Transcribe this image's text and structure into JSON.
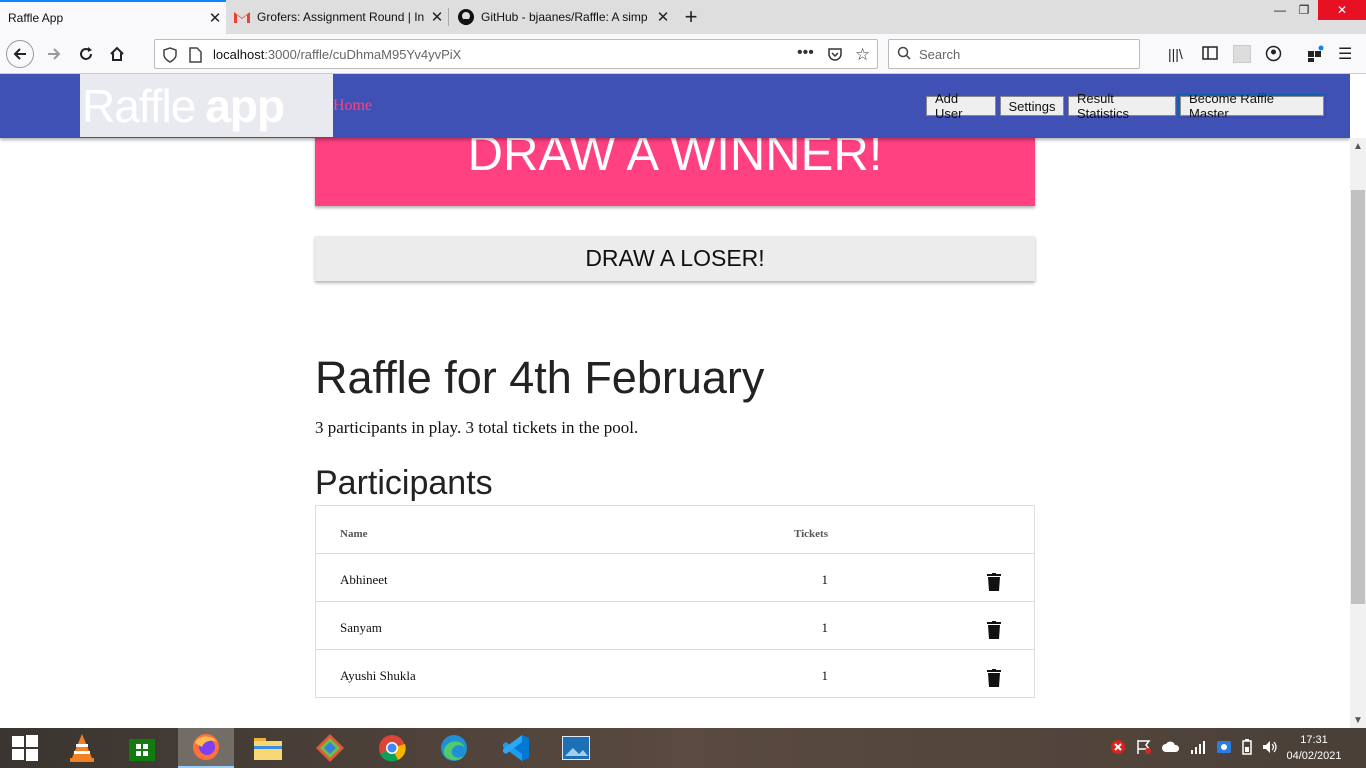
{
  "browser": {
    "tabs": [
      {
        "title": "Raffle App",
        "active": true,
        "icon": "page-icon"
      },
      {
        "title": "Grofers: Assignment Round | In",
        "active": false,
        "icon": "gmail-icon"
      },
      {
        "title": "GitHub - bjaanes/Raffle: A simp",
        "active": false,
        "icon": "github-icon"
      }
    ],
    "url_host": "localhost",
    "url_rest": ":3000/raffle/cuDhmaM95Yv4yvPiX",
    "search_placeholder": "Search"
  },
  "app": {
    "logo_light": "Raffle",
    "logo_bold": "app",
    "home_link": "Home",
    "header_buttons": [
      "Add User",
      "Settings",
      "Result Statistics",
      "Become Raffle Master"
    ],
    "draw_winner": "DRAW A WINNER!",
    "draw_loser": "DRAW A LOSER!",
    "raffle_title": "Raffle for 4th February",
    "summary": "3 participants in play. 3 total tickets in the pool.",
    "participants_heading": "Participants",
    "table": {
      "headers": {
        "name": "Name",
        "tickets": "Tickets"
      },
      "rows": [
        {
          "name": "Abhineet",
          "tickets": "1"
        },
        {
          "name": "Sanyam",
          "tickets": "1"
        },
        {
          "name": "Ayushi Shukla",
          "tickets": "1"
        }
      ]
    },
    "colors": {
      "primary": "#3f51b5",
      "accent": "#ff4081"
    }
  },
  "taskbar": {
    "time": "17:31",
    "date": "04/02/2021"
  }
}
